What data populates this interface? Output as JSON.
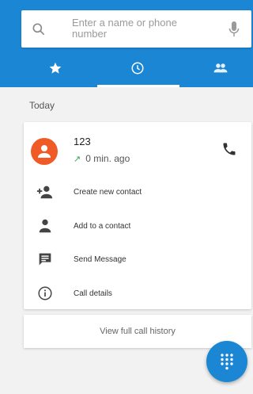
{
  "search": {
    "placeholder": "Enter a name or phone number",
    "search_icon": "search-icon",
    "mic_icon": "mic-icon",
    "more_icon": "more-vert-icon"
  },
  "tabs": [
    {
      "icon": "star-icon",
      "label": "Favorites",
      "selected": false
    },
    {
      "icon": "clock-icon",
      "label": "Recents",
      "selected": true
    },
    {
      "icon": "people-icon",
      "label": "Contacts",
      "selected": false
    }
  ],
  "section": {
    "label": "Today"
  },
  "call": {
    "name": "123",
    "time": "0 min. ago",
    "direction_icon": "outgoing-arrow-icon",
    "avatar_icon": "person-icon",
    "call_icon": "phone-icon"
  },
  "actions": [
    {
      "label": "Create new contact",
      "icon": "person-add-icon"
    },
    {
      "label": "Add to a contact",
      "icon": "person-icon"
    },
    {
      "label": "Send Message",
      "icon": "message-icon"
    },
    {
      "label": "Call details",
      "icon": "info-icon"
    }
  ],
  "history": {
    "label": "View full call history"
  },
  "fab": {
    "icon": "dialpad-icon"
  },
  "colors": {
    "primary": "#1a86d4",
    "avatar": "#f05a27",
    "outgoing": "#2eaa4a"
  }
}
